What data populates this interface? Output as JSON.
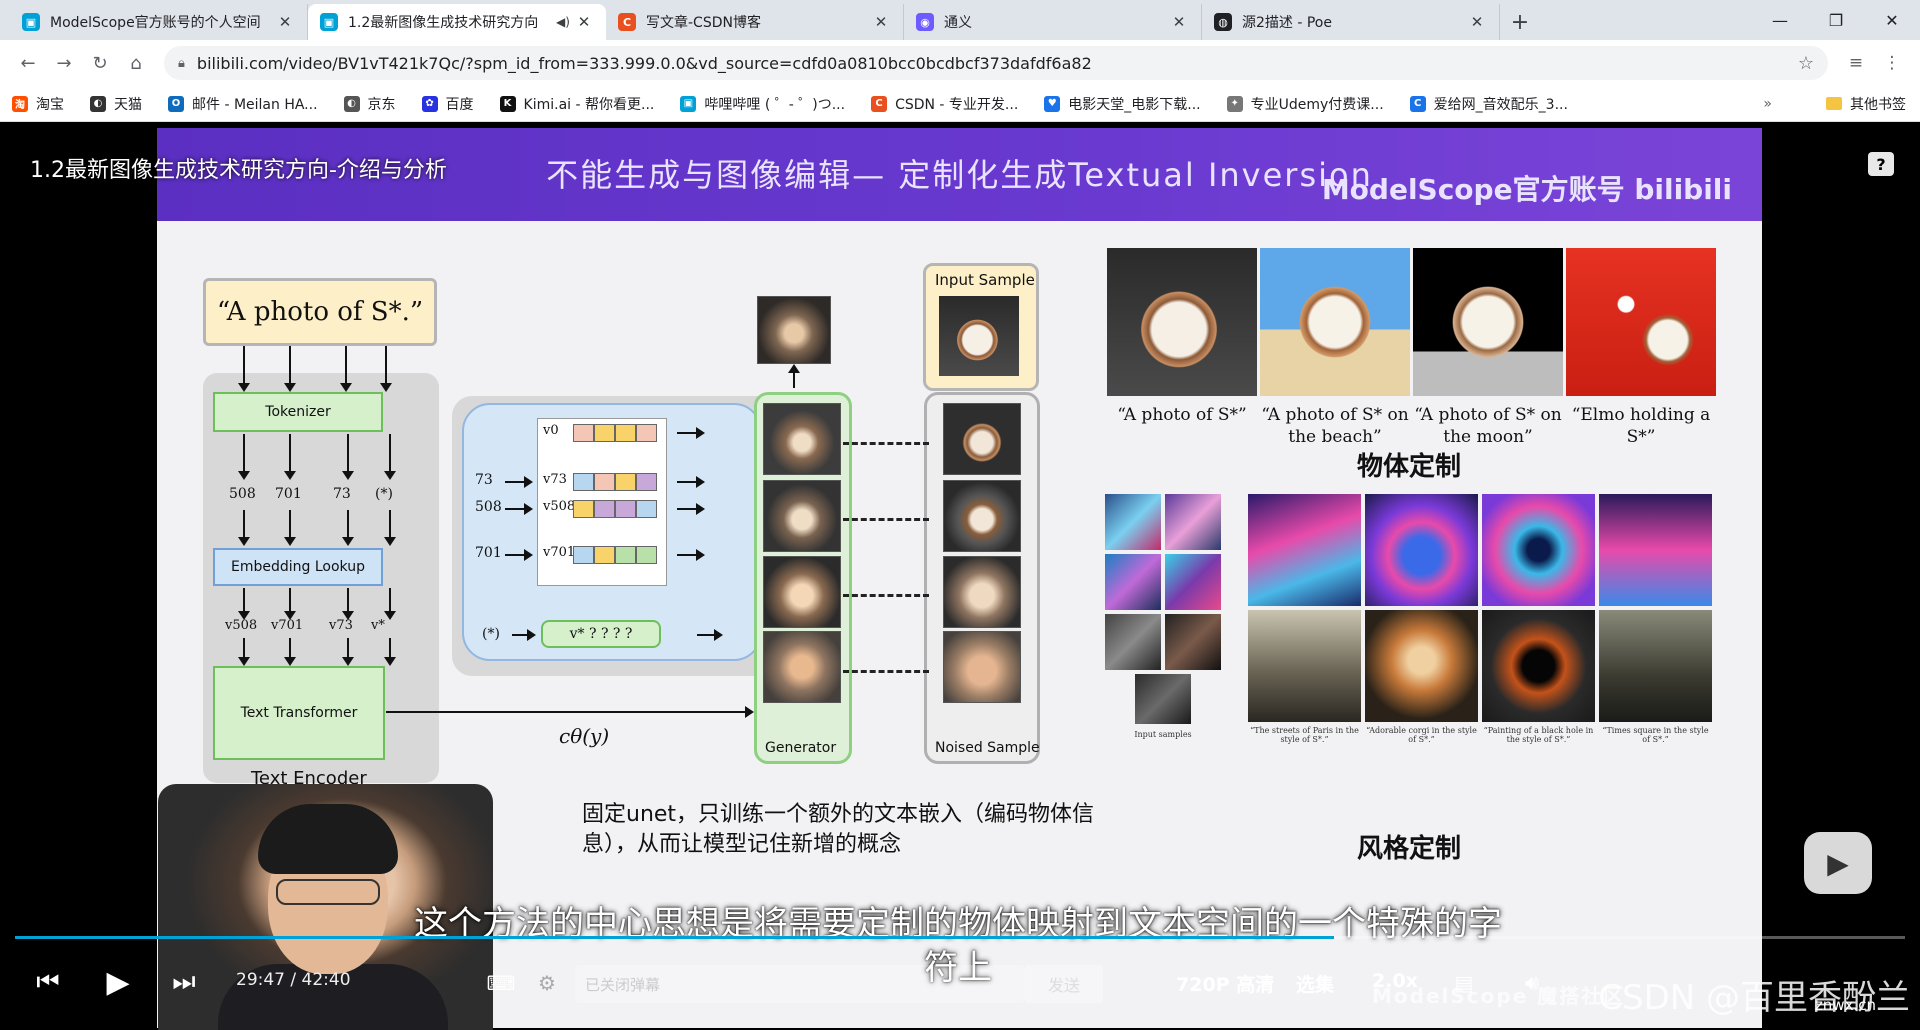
{
  "tabs": [
    {
      "title": "ModelScope官方账号的个人空间",
      "favicon_color": "#00a1d6",
      "favicon_glyph": "▣"
    },
    {
      "title": "1.2最新图像生成技术研究方向",
      "favicon_color": "#00a1d6",
      "favicon_glyph": "▣",
      "active": true
    },
    {
      "title": "写文章-CSDN博客",
      "favicon_color": "#e8501f",
      "favicon_glyph": "C"
    },
    {
      "title": "通义",
      "favicon_color": "#6e5bff",
      "favicon_glyph": "◉"
    },
    {
      "title": "源2描述 - Poe",
      "favicon_color": "#202124",
      "favicon_glyph": "◍"
    }
  ],
  "window": {
    "minimize": "—",
    "maximize": "❐",
    "close": "✕",
    "new_tab": "+"
  },
  "address": {
    "url": "bilibili.com/video/BV1vT421k7Qc/?spm_id_from=333.999.0.0&vd_source=cdfd0a0810bcc0bcdbcf373dafdf6a82"
  },
  "bookmarks": [
    {
      "label": "淘宝",
      "color": "#ff5000",
      "glyph": "淘"
    },
    {
      "label": "天猫",
      "color": "#333333",
      "glyph": "◐"
    },
    {
      "label": "邮件 - Meilan HA...",
      "color": "#0f6cbd",
      "glyph": "O"
    },
    {
      "label": "京东",
      "color": "#555555",
      "glyph": "◐"
    },
    {
      "label": "百度",
      "color": "#2932e1",
      "glyph": "✿"
    },
    {
      "label": "Kimi.ai - 帮你看更...",
      "color": "#111111",
      "glyph": "K"
    },
    {
      "label": "哔哩哔哩 ( ゜- ゜)つ...",
      "color": "#00a1d6",
      "glyph": "▣"
    },
    {
      "label": "CSDN - 专业开发...",
      "color": "#e8501f",
      "glyph": "C"
    },
    {
      "label": "电影天堂_电影下载...",
      "color": "#1a73e8",
      "glyph": "♥"
    },
    {
      "label": "专业Udemy付费课...",
      "color": "#777777",
      "glyph": "✦"
    },
    {
      "label": "爱给网_音效配乐_3...",
      "color": "#1a73e8",
      "glyph": "C"
    }
  ],
  "bookmarks_more": "»",
  "bookmarks_other": "其他书签",
  "video": {
    "title": "1.2最新图像生成技术研究方向-介绍与分析",
    "slide_title": "不能生成与图像编辑— 定制化生成Textual Inversion",
    "slide_brand": "ModelScope官方账号 bilibili",
    "diagram": {
      "prompt": "“A photo of S*.”",
      "tokenizer": "Tokenizer",
      "token_ids": [
        "508",
        "701",
        "73",
        "(*)"
      ],
      "embedding_lookup": "Embedding Lookup",
      "vectors": [
        "v508",
        "v701",
        "v73",
        "v*"
      ],
      "text_transformer": "Text Transformer",
      "text_encoder": "Text Encoder",
      "lookup_rows": [
        "v0",
        "v73",
        "v508",
        "v701"
      ],
      "lookup_ids": [
        "73",
        "508",
        "701"
      ],
      "star_id": "(*)",
      "star_vec": "v*",
      "unknowns": "? ? ? ?",
      "conditioning": "cθ(y)",
      "generator": "Generator",
      "noised_sample": "Noised Sample",
      "input_sample": "Input Sample"
    },
    "object_captions": [
      "“A photo of S*”",
      "“A photo of S* on the beach”",
      "“A photo of S* on the moon”",
      "“Elmo holding a S*”"
    ],
    "object_heading": "物体定制",
    "style_heading": "风格定制",
    "style_captions": [
      "Input samples",
      "“The streets of Paris in the style of S*.”",
      "“Adorable corgi in the style of S*.”",
      "“Painting of a black hole in the style of S*.”",
      "“Times square in the style of S*.”"
    ],
    "note": "固定unet，只训练一个额外的文本嵌入（编码物体信息），从而让模型记住新增的概念",
    "subtitle_line1": "这个方法的中心思想是将需要定制的物体映射到文本空间的一个特殊的字",
    "subtitle_line2": "符上"
  },
  "controls": {
    "current_time": "29:47",
    "separator": "/",
    "duration": "42:40",
    "progress": 0.698,
    "danmaku_placeholder": "已关闭弹幕",
    "send": "发送",
    "quality": "720P 高清",
    "episodes": "选集",
    "speed": "2.0x",
    "watermark": "CSDN @百里香酚兰",
    "watermark_small": "znwx.cn",
    "modelscope": "ModelScope 魔搭社区"
  }
}
